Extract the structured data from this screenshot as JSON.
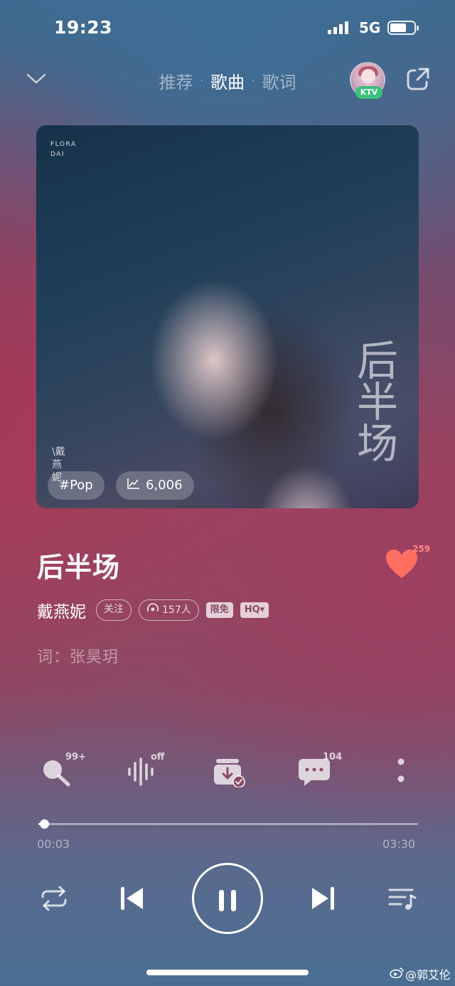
{
  "status_bar": {
    "time": "19:23",
    "network": "5G"
  },
  "header": {
    "tabs": [
      {
        "label": "推荐",
        "active": false
      },
      {
        "label": "歌曲",
        "active": true
      },
      {
        "label": "歌词",
        "active": false
      }
    ],
    "ktv_label": "KTV"
  },
  "cover": {
    "artist_tag_line1": "FLORA",
    "artist_tag_line2": "DAI",
    "cover_title": "后半场",
    "cover_artist_vertical": "\\戴燕妮",
    "genre_tag": "#Pop",
    "trend_count": "6,006"
  },
  "song": {
    "title": "后半场",
    "like_count": "259",
    "singer": "戴燕妮",
    "follow_label": "关注",
    "listeners_label": "157人",
    "free_label": "限免",
    "quality_label": "HQ▾",
    "lyricist": "词：张昊玥"
  },
  "functions": {
    "search_count": "99+",
    "effect_state": "off",
    "comment_count": "104"
  },
  "progress": {
    "current": "00:03",
    "total": "03:30",
    "fraction": 0.015
  },
  "watermark": "@郭艾伦",
  "colors": {
    "like": "#ff6f61",
    "ktv_badge": "#3bc07a"
  }
}
